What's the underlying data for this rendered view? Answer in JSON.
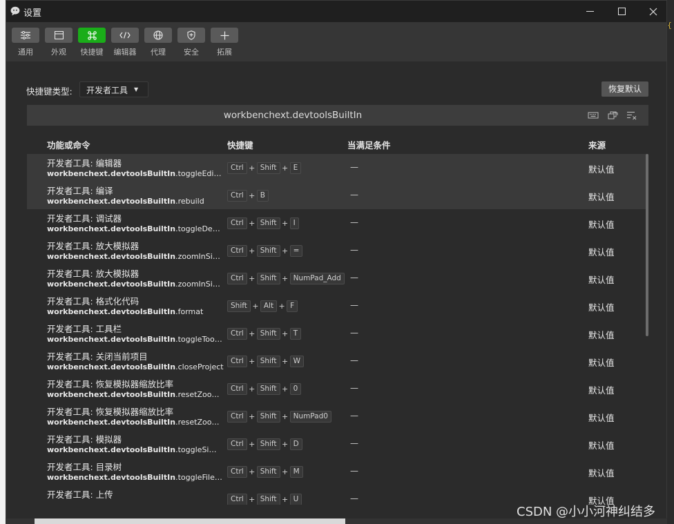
{
  "window": {
    "title": "设置"
  },
  "toolbar": {
    "items": [
      {
        "label": "通用",
        "icon": "sliders-icon"
      },
      {
        "label": "外观",
        "icon": "layout-icon"
      },
      {
        "label": "快捷键",
        "icon": "command-icon",
        "active": true
      },
      {
        "label": "编辑器",
        "icon": "code-icon"
      },
      {
        "label": "代理",
        "icon": "globe-icon"
      },
      {
        "label": "安全",
        "icon": "shield-icon"
      },
      {
        "label": "拓展",
        "icon": "plus-icon"
      }
    ]
  },
  "shortcut_type": {
    "label": "快捷键类型:",
    "selected": "开发者工具"
  },
  "restore_button": "恢复默认",
  "search": {
    "value": "workbenchext.devtoolsBuiltIn"
  },
  "columns": {
    "command": "功能或命令",
    "keybinding": "快捷键",
    "when": "当满足条件",
    "source": "来源"
  },
  "rows": [
    {
      "title": "开发者工具: 编辑器",
      "id_prefix": "workbenchext.devtoolsBuiltIn",
      "id_suffix": ".toggleEditorWi...",
      "keys": [
        "Ctrl",
        "Shift",
        "E"
      ],
      "when": "—",
      "source": "默认值"
    },
    {
      "title": "开发者工具: 编译",
      "id_prefix": "workbenchext.devtoolsBuiltIn",
      "id_suffix": ".rebuild",
      "keys": [
        "Ctrl",
        "B"
      ],
      "when": "—",
      "source": "默认值"
    },
    {
      "title": "开发者工具: 调试器",
      "id_prefix": "workbenchext.devtoolsBuiltIn",
      "id_suffix": ".toggleDebug...",
      "keys": [
        "Ctrl",
        "Shift",
        "I"
      ],
      "when": "—",
      "source": "默认值"
    },
    {
      "title": "开发者工具: 放大模拟器",
      "id_prefix": "workbenchext.devtoolsBuiltIn",
      "id_suffix": ".zoomInSimulat...",
      "keys": [
        "Ctrl",
        "Shift",
        "="
      ],
      "when": "—",
      "source": "默认值"
    },
    {
      "title": "开发者工具: 放大模拟器",
      "id_prefix": "workbenchext.devtoolsBuiltIn",
      "id_suffix": ".zoomInSimulat...",
      "keys": [
        "Ctrl",
        "Shift",
        "NumPad_Add"
      ],
      "when": "—",
      "source": "默认值"
    },
    {
      "title": "开发者工具: 格式化代码",
      "id_prefix": "workbenchext.devtoolsBuiltIn",
      "id_suffix": ".format",
      "keys": [
        "Shift",
        "Alt",
        "F"
      ],
      "when": "—",
      "source": "默认值"
    },
    {
      "title": "开发者工具: 工具栏",
      "id_prefix": "workbenchext.devtoolsBuiltIn",
      "id_suffix": ".toggleToolbar",
      "keys": [
        "Ctrl",
        "Shift",
        "T"
      ],
      "when": "—",
      "source": "默认值"
    },
    {
      "title": "开发者工具: 关闭当前项目",
      "id_prefix": "workbenchext.devtoolsBuiltIn",
      "id_suffix": ".closeProject",
      "keys": [
        "Ctrl",
        "Shift",
        "W"
      ],
      "when": "—",
      "source": "默认值"
    },
    {
      "title": "开发者工具: 恢复模拟器缩放比率",
      "id_prefix": "workbenchext.devtoolsBuiltIn",
      "id_suffix": ".resetZoomSim...",
      "keys": [
        "Ctrl",
        "Shift",
        "0"
      ],
      "when": "—",
      "source": "默认值"
    },
    {
      "title": "开发者工具: 恢复模拟器缩放比率",
      "id_prefix": "workbenchext.devtoolsBuiltIn",
      "id_suffix": ".resetZoomSim...",
      "keys": [
        "Ctrl",
        "Shift",
        "NumPad0"
      ],
      "when": "—",
      "source": "默认值"
    },
    {
      "title": "开发者工具: 模拟器",
      "id_prefix": "workbenchext.devtoolsBuiltIn",
      "id_suffix": ".toggleSimulat...",
      "keys": [
        "Ctrl",
        "Shift",
        "D"
      ],
      "when": "—",
      "source": "默认值"
    },
    {
      "title": "开发者工具: 目录树",
      "id_prefix": "workbenchext.devtoolsBuiltIn",
      "id_suffix": ".toggleFileTree",
      "keys": [
        "Ctrl",
        "Shift",
        "M"
      ],
      "when": "—",
      "source": "默认值"
    },
    {
      "title": "开发者工具: 上传",
      "id_prefix": "",
      "id_suffix": "",
      "keys": [
        "Ctrl",
        "Shift",
        "U"
      ],
      "when": "—",
      "source": "默认值"
    }
  ],
  "watermark": "CSDN @小小河神纠结多"
}
